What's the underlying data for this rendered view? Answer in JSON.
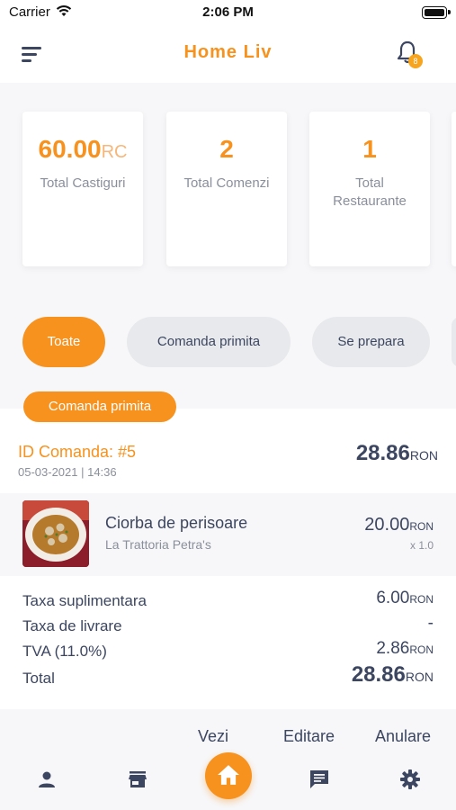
{
  "status_bar": {
    "carrier": "Carrier",
    "time": "2:06 PM"
  },
  "header": {
    "title": "Home Liv",
    "notification_count": "8"
  },
  "stats": [
    {
      "value": "60.00",
      "unit": "RC",
      "label": "Total Castiguri"
    },
    {
      "value": "2",
      "label": "Total Comenzi"
    },
    {
      "value": "1",
      "label": "Total Restaurante"
    }
  ],
  "filters": [
    "Toate",
    "Comanda primita",
    "Se prepara"
  ],
  "status_pill": "Comanda primita",
  "order": {
    "id": "ID Comanda: #5",
    "date": "05-03-2021 | 14:36",
    "total": "28.86",
    "currency": "RON",
    "items": [
      {
        "name": "Ciorba de perisoare",
        "restaurant": "La Trattoria Petra's",
        "price": "20.00",
        "qty": "x 1.0"
      }
    ],
    "summary": [
      {
        "label": "Taxa suplimentara",
        "value": "6.00"
      },
      {
        "label": "Taxa de livrare",
        "value": "-"
      },
      {
        "label": "TVA (11.0%)",
        "value": "2.86"
      },
      {
        "label": "Total",
        "value": "28.86"
      }
    ]
  },
  "actions": [
    "Vezi",
    "Editare",
    "Anulare"
  ],
  "tabbar": [
    "person-icon",
    "store-icon",
    "home-icon",
    "chat-icon",
    "settings-icon"
  ],
  "colors": {
    "accent": "#f7921e",
    "text": "#3c4660",
    "muted": "#8a8f9c",
    "chip_bg": "#e8e9ec",
    "surface": "#f7f7f9"
  }
}
